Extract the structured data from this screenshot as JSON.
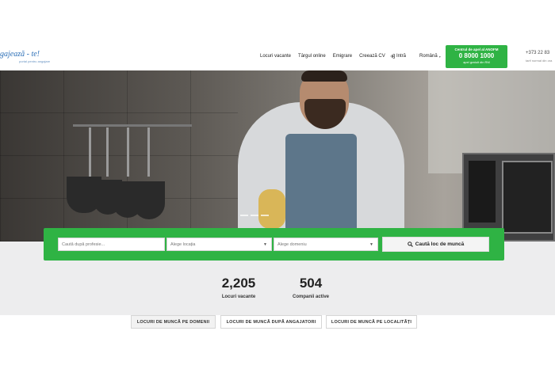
{
  "header": {
    "logo_text": "gajează - te!",
    "logo_sub": "portal pentru angajare",
    "nav": [
      "Locuri vacante",
      "Târgul online",
      "Emigrare",
      "Creează CV"
    ],
    "login": "Intră",
    "language": "Română",
    "callbox": {
      "title": "Centrul de apel al ANOFM",
      "number": "0 8000 1000",
      "sub": "apel gratuit din RM"
    },
    "phone": "+373 22 83",
    "phone_sub": "tarif normal din ora"
  },
  "search": {
    "profession_placeholder": "Caută după profesie...",
    "location_placeholder": "Alege locația",
    "domain_placeholder": "Alege domeniu",
    "button_label": "Caută loc de muncă"
  },
  "stats": [
    {
      "value": "2,205",
      "label": "Locuri vacante"
    },
    {
      "value": "504",
      "label": "Companii active"
    }
  ],
  "tabs": [
    "LOCURI DE MUNCĂ PE DOMENII",
    "LOCURI DE MUNCĂ DUPĂ ANGAJATORI",
    "LOCURI DE MUNCĂ PE LOCALITĂȚI"
  ],
  "colors": {
    "brand_green": "#2fb344",
    "logo_blue": "#2c6fb7"
  }
}
